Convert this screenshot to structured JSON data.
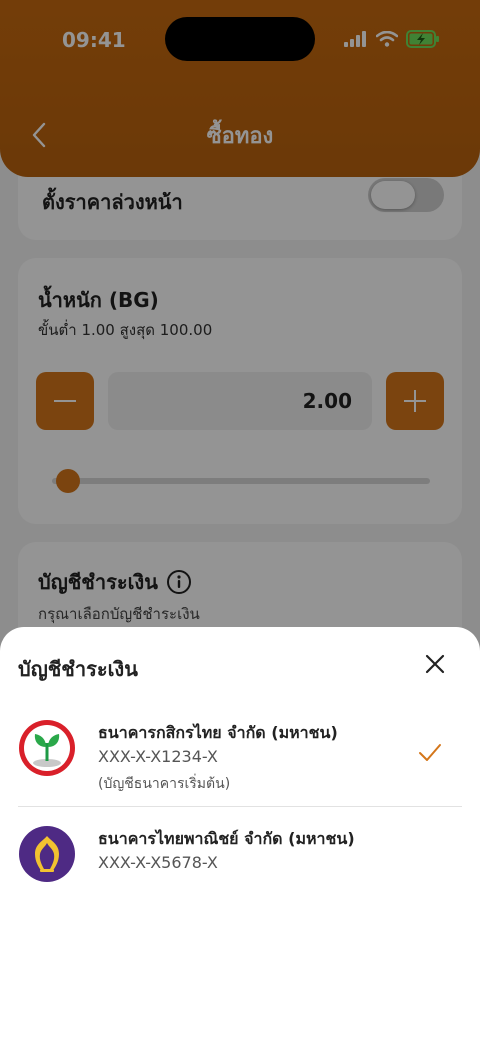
{
  "status_bar": {
    "time": "09:41"
  },
  "header": {
    "title": "ซื้อทอง"
  },
  "preset": {
    "label": "ตั้งราคาล่วงหน้า",
    "enabled": false
  },
  "weight": {
    "title": "น้ำหนัก (BG)",
    "range": "ขั้นต่ำ 1.00   สูงสุด 100.00",
    "value": "2.00",
    "slider_fraction": 0.01
  },
  "account_card": {
    "title": "บัญชีชำระเงิน",
    "hint": "กรุณาเลือกบัญชีชำระเงิน"
  },
  "sheet": {
    "title": "บัญชีชำระเงิน",
    "banks": [
      {
        "name": "ธนาคารกสิกรไทย จำกัด (มหาชน)",
        "account": "XXX-X-X1234-X",
        "note": "(บัญชีธนาคารเริ่มต้น)",
        "selected": true,
        "icon": "kbank-logo-icon",
        "color": "#2aa84a"
      },
      {
        "name": "ธนาคารไทยพาณิชย์ จำกัด (มหาชน)",
        "account": "XXX-X-X5678-X",
        "selected": false,
        "icon": "scb-logo-icon",
        "color": "#4e2a84"
      }
    ]
  },
  "colors": {
    "brand": "#c76a10",
    "accent": "#d4761a"
  }
}
